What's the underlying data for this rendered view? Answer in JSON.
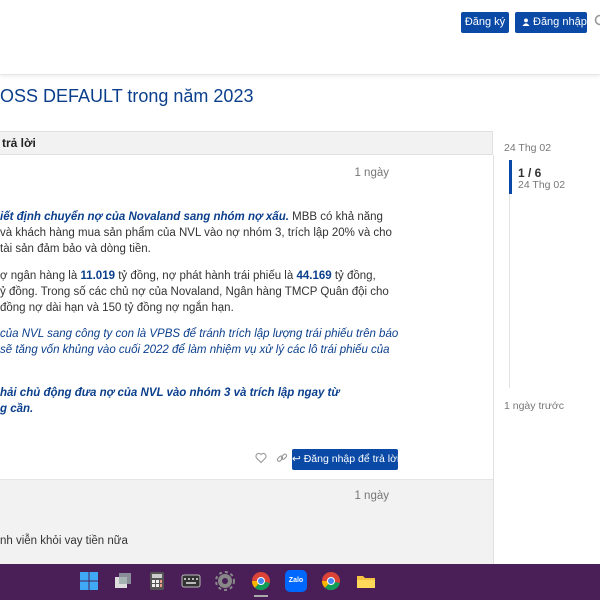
{
  "header": {
    "signup_label": "Đăng ký",
    "login_label": "Đăng nhập"
  },
  "topic": {
    "title": "OSS DEFAULT trong năm 2023",
    "replies_label": "trả lời"
  },
  "post1": {
    "age": "1 ngày",
    "p1_l1_bi": "iết định chuyển nợ của Novaland sang nhóm nợ xấu.",
    "p1_l1_rest": " MBB có khả năng",
    "p1_l2": "và khách hàng mua sản phẩm của NVL vào nợ nhóm 3, trích lập 20% và cho",
    "p1_l3": "tài sản đảm bảo và dòng tiền.",
    "p2_l1_a": "ợ ngân hàng là ",
    "p2_l1_v1": "11.019",
    "p2_l1_b": " tỷ đồng, nợ phát hành trái phiếu là ",
    "p2_l1_v2": "44.169",
    "p2_l1_c": " tỷ đồng,",
    "p2_l2": "ỷ đồng. Trong số các chủ nợ của Novaland, Ngân hàng TMCP Quân đội cho",
    "p2_l3": "đồng nợ dài hạn và 150 tỷ đồng nợ ngắn hạn.",
    "p3_l1": "của NVL sang công ty con là VPBS để tránh trích lập lượng trái phiếu trên báo",
    "p3_l2": "sẽ tăng vốn khủng vào cuối 2022 để làm nhiệm vụ xử lý các lô trái phiếu của",
    "p4_l1": "hải chủ động đưa nợ của NVL vào nhóm 3 và trích lập ngay từ",
    "p4_l2": "g cần.",
    "reply_button": "Đăng nhập để trả lời"
  },
  "post2": {
    "age": "1 ngày",
    "text": "nh viễn khỏi vay tiền nữa"
  },
  "timeline": {
    "top_date": "24 Thg 02",
    "position": "1 / 6",
    "current_date": "24 Thg 02",
    "bottom_label": "1 ngày trước"
  },
  "taskbar": {
    "icons": [
      "windows-start-icon",
      "task-view-icon",
      "calculator-icon",
      "keyboard-icon",
      "settings-icon",
      "chrome-icon",
      "zalo-icon",
      "chrome-icon",
      "file-explorer-icon"
    ],
    "zalo_label": "Zalo"
  }
}
